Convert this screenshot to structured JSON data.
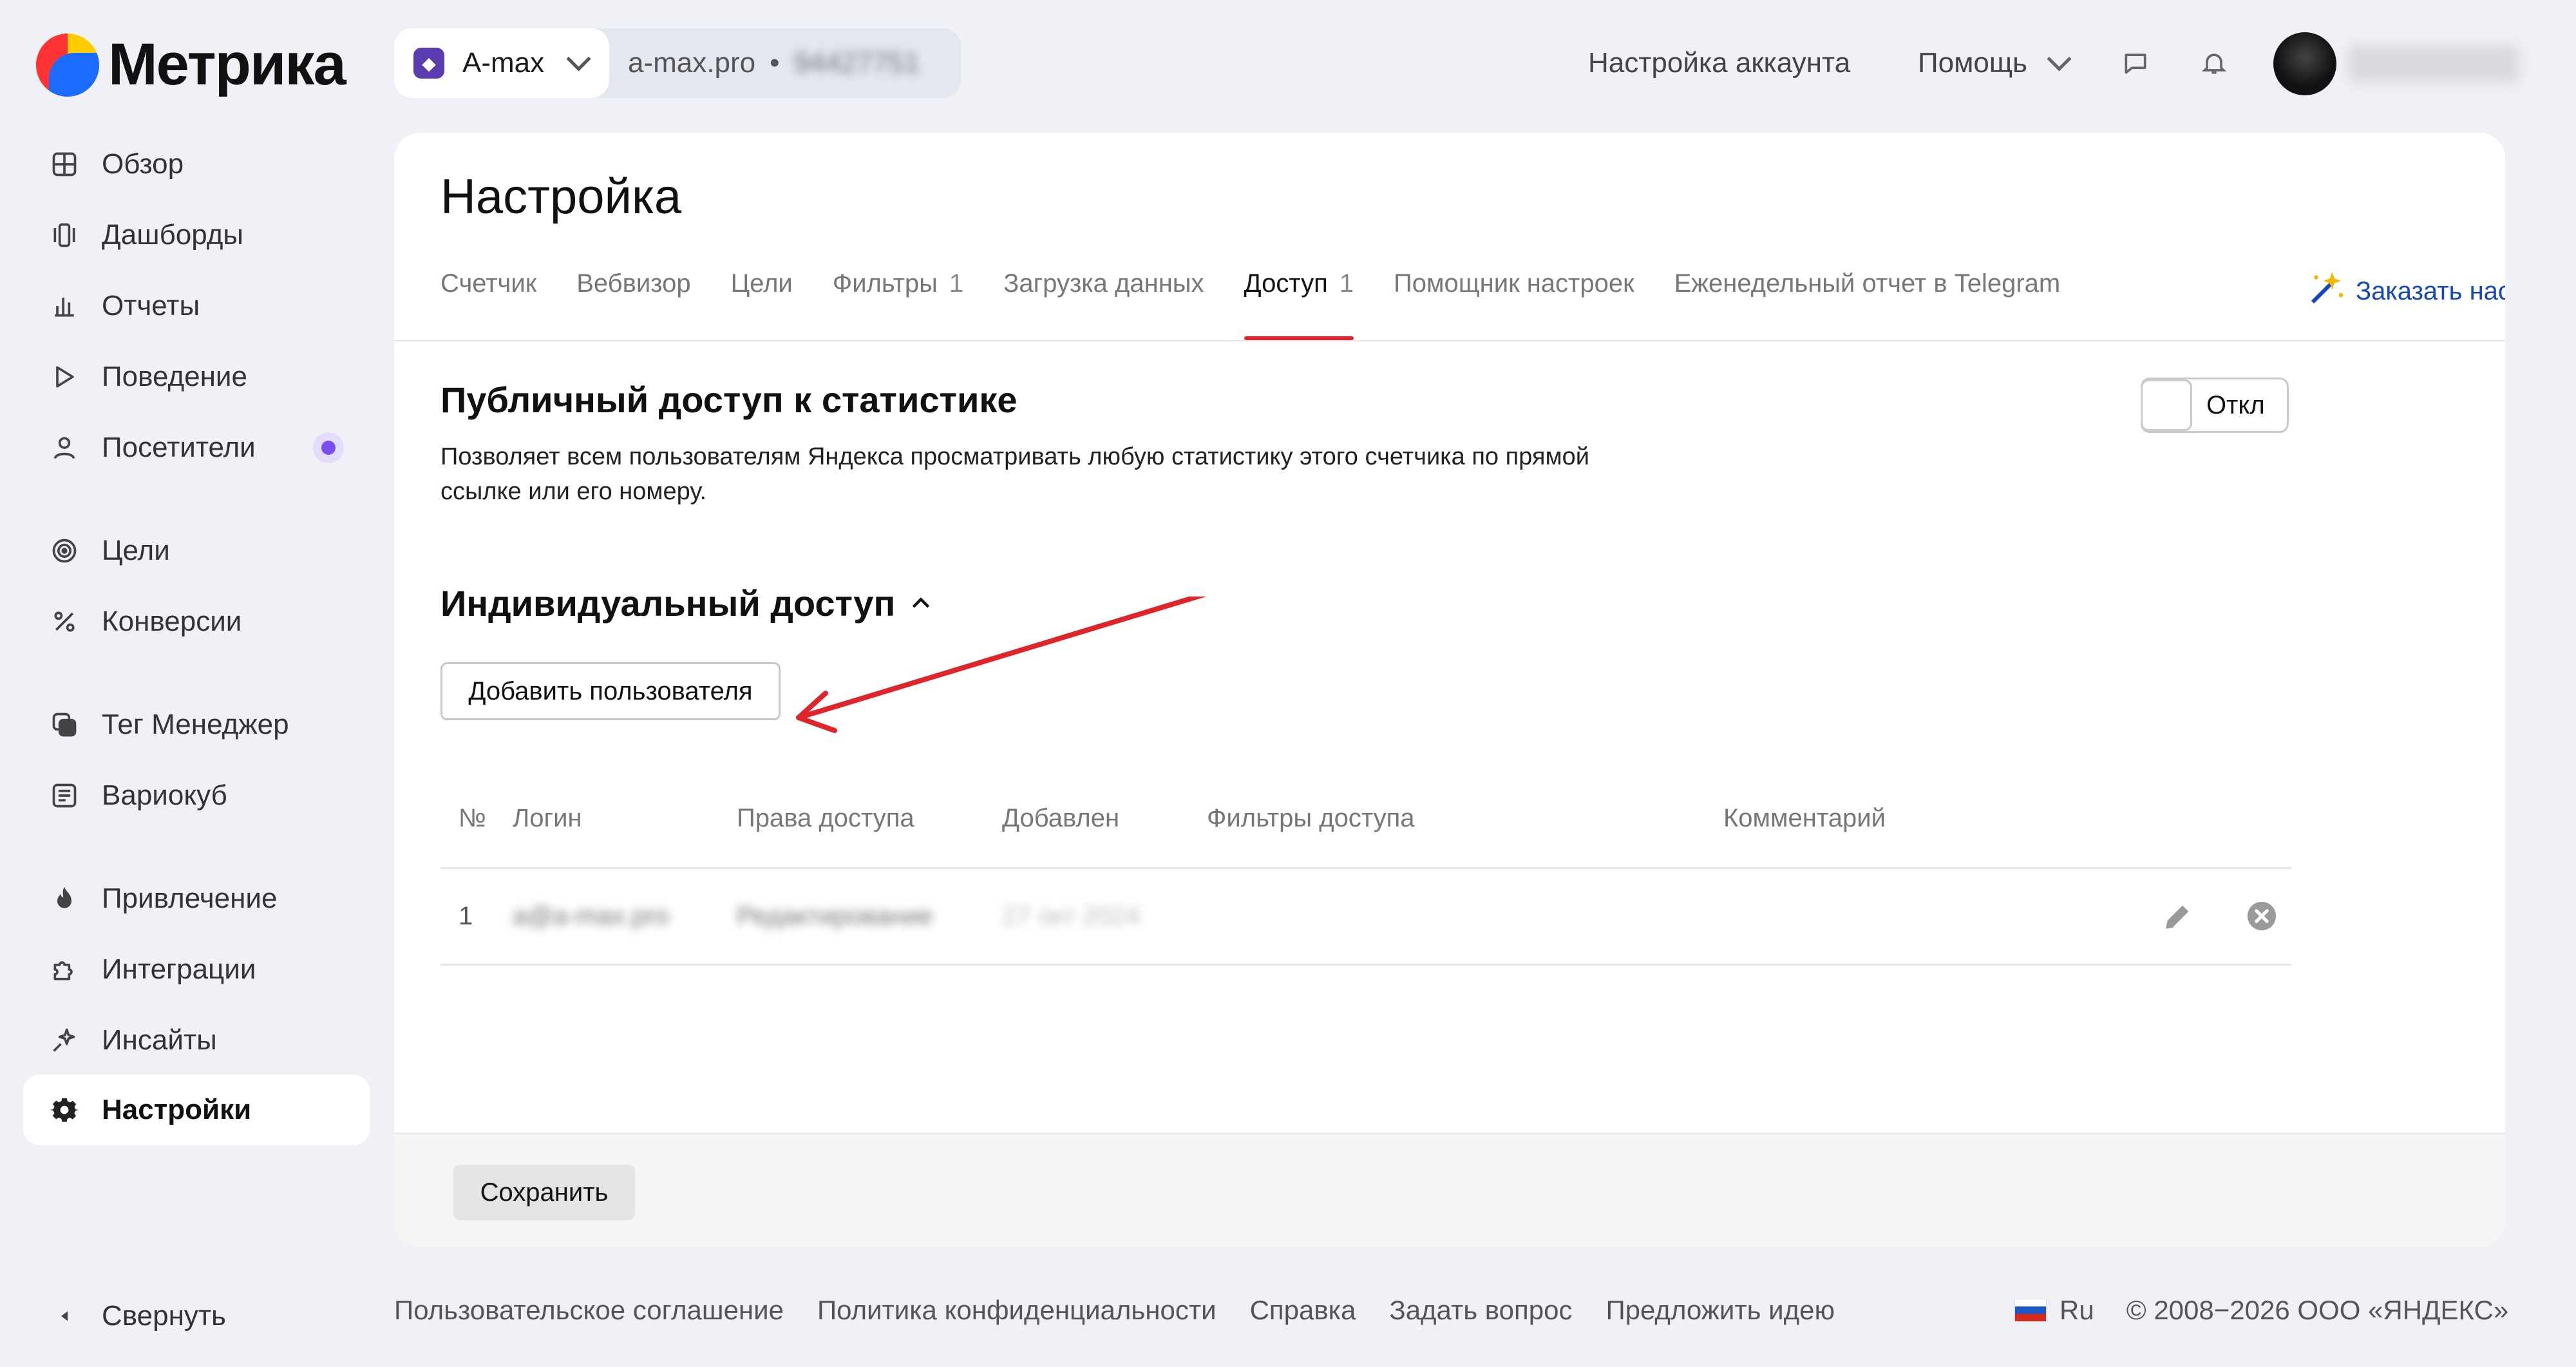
{
  "app": {
    "name": "Метрика"
  },
  "header": {
    "counter_name": "A-max",
    "counter_domain": "a-max.pro",
    "counter_separator": "•",
    "counter_id": "94427751",
    "account_settings": "Настройка аккаунта",
    "help": "Помощь"
  },
  "sidebar": {
    "items": [
      {
        "label": "Обзор",
        "icon": "grid-icon"
      },
      {
        "label": "Дашборды",
        "icon": "dashboards-icon"
      },
      {
        "label": "Отчеты",
        "icon": "bar-chart-icon"
      },
      {
        "label": "Поведение",
        "icon": "play-icon"
      },
      {
        "label": "Посетители",
        "icon": "user-icon"
      },
      {
        "label": "Цели",
        "icon": "target-icon"
      },
      {
        "label": "Конверсии",
        "icon": "percent-icon"
      },
      {
        "label": "Тег Менеджер",
        "icon": "tag-manager-icon"
      },
      {
        "label": "Вариокуб",
        "icon": "variocube-icon"
      },
      {
        "label": "Привлечение",
        "icon": "fire-icon"
      },
      {
        "label": "Интеграции",
        "icon": "puzzle-icon"
      },
      {
        "label": "Инсайты",
        "icon": "sparkle-icon"
      },
      {
        "label": "Настройки",
        "icon": "gear-icon"
      }
    ],
    "collapse": "Свернуть",
    "active": "Настройки"
  },
  "page": {
    "title": "Настройка",
    "tabs": [
      {
        "label": "Счетчик",
        "count": ""
      },
      {
        "label": "Вебвизор",
        "count": ""
      },
      {
        "label": "Цели",
        "count": ""
      },
      {
        "label": "Фильтры",
        "count": "1"
      },
      {
        "label": "Загрузка данных",
        "count": ""
      },
      {
        "label": "Доступ",
        "count": "1"
      },
      {
        "label": "Помощник настроек",
        "count": ""
      },
      {
        "label": "Еженедельный отчет в Telegram",
        "count": ""
      }
    ],
    "active_tab": "Доступ",
    "order_link": "Заказать нас",
    "public_access": {
      "title": "Публичный доступ к статистике",
      "description": "Позволяет всем пользователям Яндекса просматривать любую статистику этого счетчика по прямой ссылке или его номеру.",
      "toggle_label": "Откл",
      "enabled": false
    },
    "individual_access": {
      "title": "Индивидуальный доступ",
      "add_user": "Добавить пользователя",
      "columns": [
        "№",
        "Логин",
        "Права доступа",
        "Добавлен",
        "Фильтры доступа",
        "Комментарий"
      ],
      "rows": [
        {
          "num": "1",
          "login": "a@a-max.pro",
          "rights": "Редактирование",
          "added": "27 окт 2024",
          "filters": "",
          "comment": ""
        }
      ]
    },
    "save": "Сохранить"
  },
  "footer": {
    "links": [
      "Пользовательское соглашение",
      "Политика конфиденциальности",
      "Справка",
      "Задать вопрос",
      "Предложить идею"
    ],
    "lang": "Ru",
    "copyright": "© 2008−2026 ООО «ЯНДЕКС»"
  },
  "colors": {
    "accent_red": "#e0252a",
    "active_dot": "#7b4cf0",
    "link_blue": "#1546c0",
    "background": "#f0f1f6"
  }
}
